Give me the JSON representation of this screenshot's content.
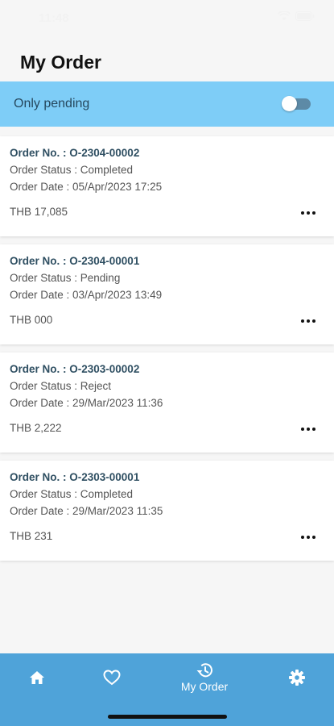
{
  "status_bar": {
    "time": "11:48"
  },
  "header": {
    "title": "My Order"
  },
  "filter": {
    "label": "Only pending",
    "enabled": false
  },
  "orders": [
    {
      "order_no": "Order No. : O-2304-00002",
      "status": "Order Status : Completed",
      "date": "Order Date : 05/Apr/2023 17:25",
      "amount": "THB 17,085"
    },
    {
      "order_no": "Order No. : O-2304-00001",
      "status": "Order Status : Pending",
      "date": "Order Date : 03/Apr/2023 13:49",
      "amount": "THB 000"
    },
    {
      "order_no": "Order No. : O-2303-00002",
      "status": "Order Status : Reject",
      "date": "Order Date : 29/Mar/2023 11:36",
      "amount": "THB 2,222"
    },
    {
      "order_no": "Order No. : O-2303-00001",
      "status": "Order Status : Completed",
      "date": "Order Date : 29/Mar/2023 11:35",
      "amount": "THB 231"
    }
  ],
  "bottom_nav": {
    "items": [
      {
        "icon": "home-icon",
        "label": ""
      },
      {
        "icon": "heart-icon",
        "label": ""
      },
      {
        "icon": "history-icon",
        "label": "My Order",
        "active": true
      },
      {
        "icon": "gear-icon",
        "label": ""
      }
    ]
  },
  "colors": {
    "filter_bar": "#7ecdf7",
    "bottom_nav": "#4fa3d9",
    "order_no_text": "#2f4f62"
  }
}
